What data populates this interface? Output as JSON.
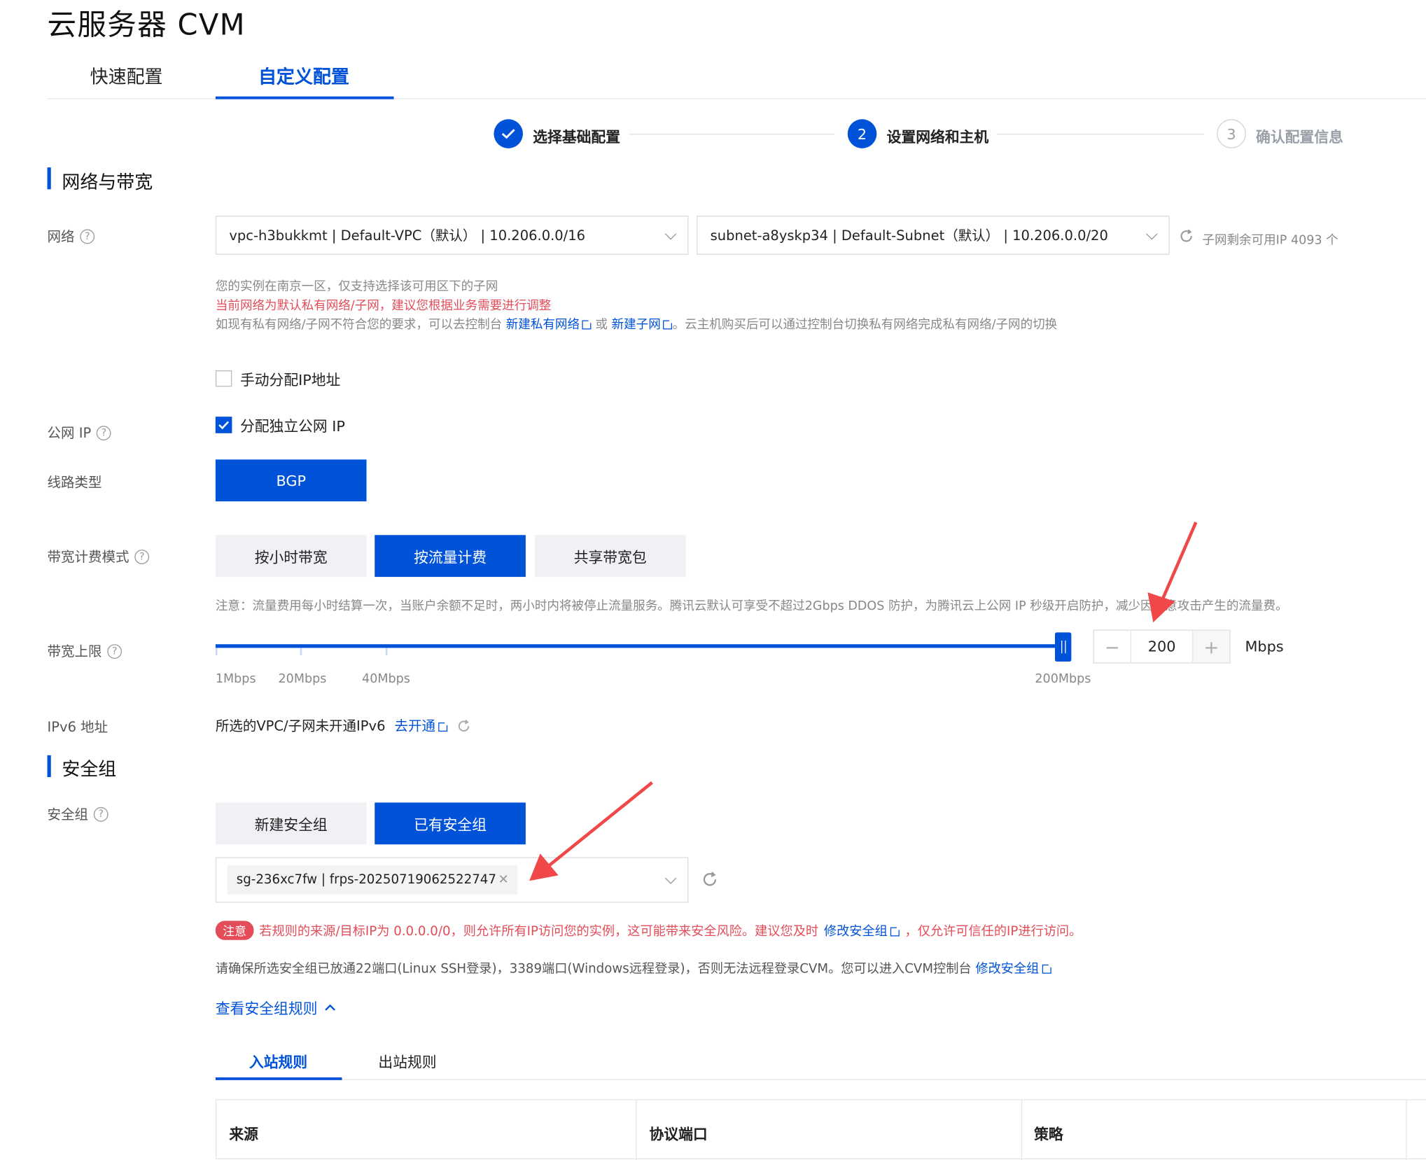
{
  "page_title": "云服务器 CVM",
  "tabs": [
    {
      "label": "快速配置",
      "active": false
    },
    {
      "label": "自定义配置",
      "active": true
    }
  ],
  "steps": [
    {
      "label": "选择基础配置",
      "status": "done",
      "mark": "✓"
    },
    {
      "label": "设置网络和主机",
      "status": "active",
      "mark": "2"
    },
    {
      "label": "确认配置信息",
      "status": "todo",
      "mark": "3"
    }
  ],
  "network_section": {
    "title": "网络与带宽",
    "network_label": "网络",
    "vpc_value": "vpc-h3bukkmt | Default-VPC（默认） | 10.206.0.0/16",
    "subnet_value": "subnet-a8yskp34 | Default-Subnet（默认） | 10.206.0.0/20",
    "subnet_remaining": "子网剩余可用IP 4093 个",
    "hint1": "您的实例在南京一区，仅支持选择该可用区下的子网",
    "hint_red": "当前网络为默认私有网络/子网，建议您根据业务需要进行调整",
    "hint3_a": "如现有私有网络/子网不符合您的要求，可以去控制台",
    "link_new_vpc": "新建私有网络",
    "hint3_b": "或",
    "link_new_subnet": "新建子网",
    "hint3_c": "。云主机购买后可以通过控制台切换私有网络完成私有网络/子网的切换",
    "manual_ip_label": "手动分配IP地址",
    "manual_ip_checked": false,
    "public_ip_label": "公网 IP",
    "public_ip_option": "分配独立公网 IP",
    "public_ip_checked": true,
    "line_type_label": "线路类型",
    "line_type_value": "BGP",
    "billing_label": "带宽计费模式",
    "billing_options": [
      "按小时带宽",
      "按流量计费",
      "共享带宽包"
    ],
    "billing_selected": "按流量计费",
    "billing_note": "注意：流量费用每小时结算一次，当账户余额不足时，两小时内将被停止流量服务。腾讯云默认可享受不超过2Gbps DDOS 防护，为腾讯云上公网 IP 秒级开启防护，减少因恶意攻击产生的流量费。",
    "bandwidth_label": "带宽上限",
    "bandwidth_ticks": [
      "1Mbps",
      "20Mbps",
      "40Mbps",
      "200Mbps"
    ],
    "bandwidth_value": "200",
    "bandwidth_unit": "Mbps",
    "bandwidth_level_fraction": 1.0,
    "ipv6_label": "IPv6 地址",
    "ipv6_text": "所选的VPC/子网未开通IPv6",
    "ipv6_link": "去开通"
  },
  "security_section": {
    "title": "安全组",
    "sg_label": "安全组",
    "sg_options": [
      "新建安全组",
      "已有安全组"
    ],
    "sg_selected": "已有安全组",
    "sg_tag": "sg-236xc7fw | frps-20250719062522747",
    "warn_badge": "注意",
    "warn_text_a": "若规则的来源/目标IP为 0.0.0.0/0，则允许所有IP访问您的实例，这可能带来安全风险。建议您及时",
    "warn_link": "修改安全组",
    "warn_text_b": "，仅允许可信任的IP进行访问。",
    "ports_text": "请确保所选安全组已放通22端口(Linux SSH登录)，3389端口(Windows远程登录)，否则无法远程登录CVM。您可以进入CVM控制台",
    "ports_link": "修改安全组",
    "view_rules": "查看安全组规则",
    "rule_tabs": [
      "入站规则",
      "出站规则"
    ],
    "rule_tab_active": "入站规则",
    "table_headers": [
      "来源",
      "协议端口",
      "策略"
    ]
  },
  "colors": {
    "primary": "#0052d9",
    "danger": "#e34d59",
    "annotation_arrow": "#f04848"
  }
}
